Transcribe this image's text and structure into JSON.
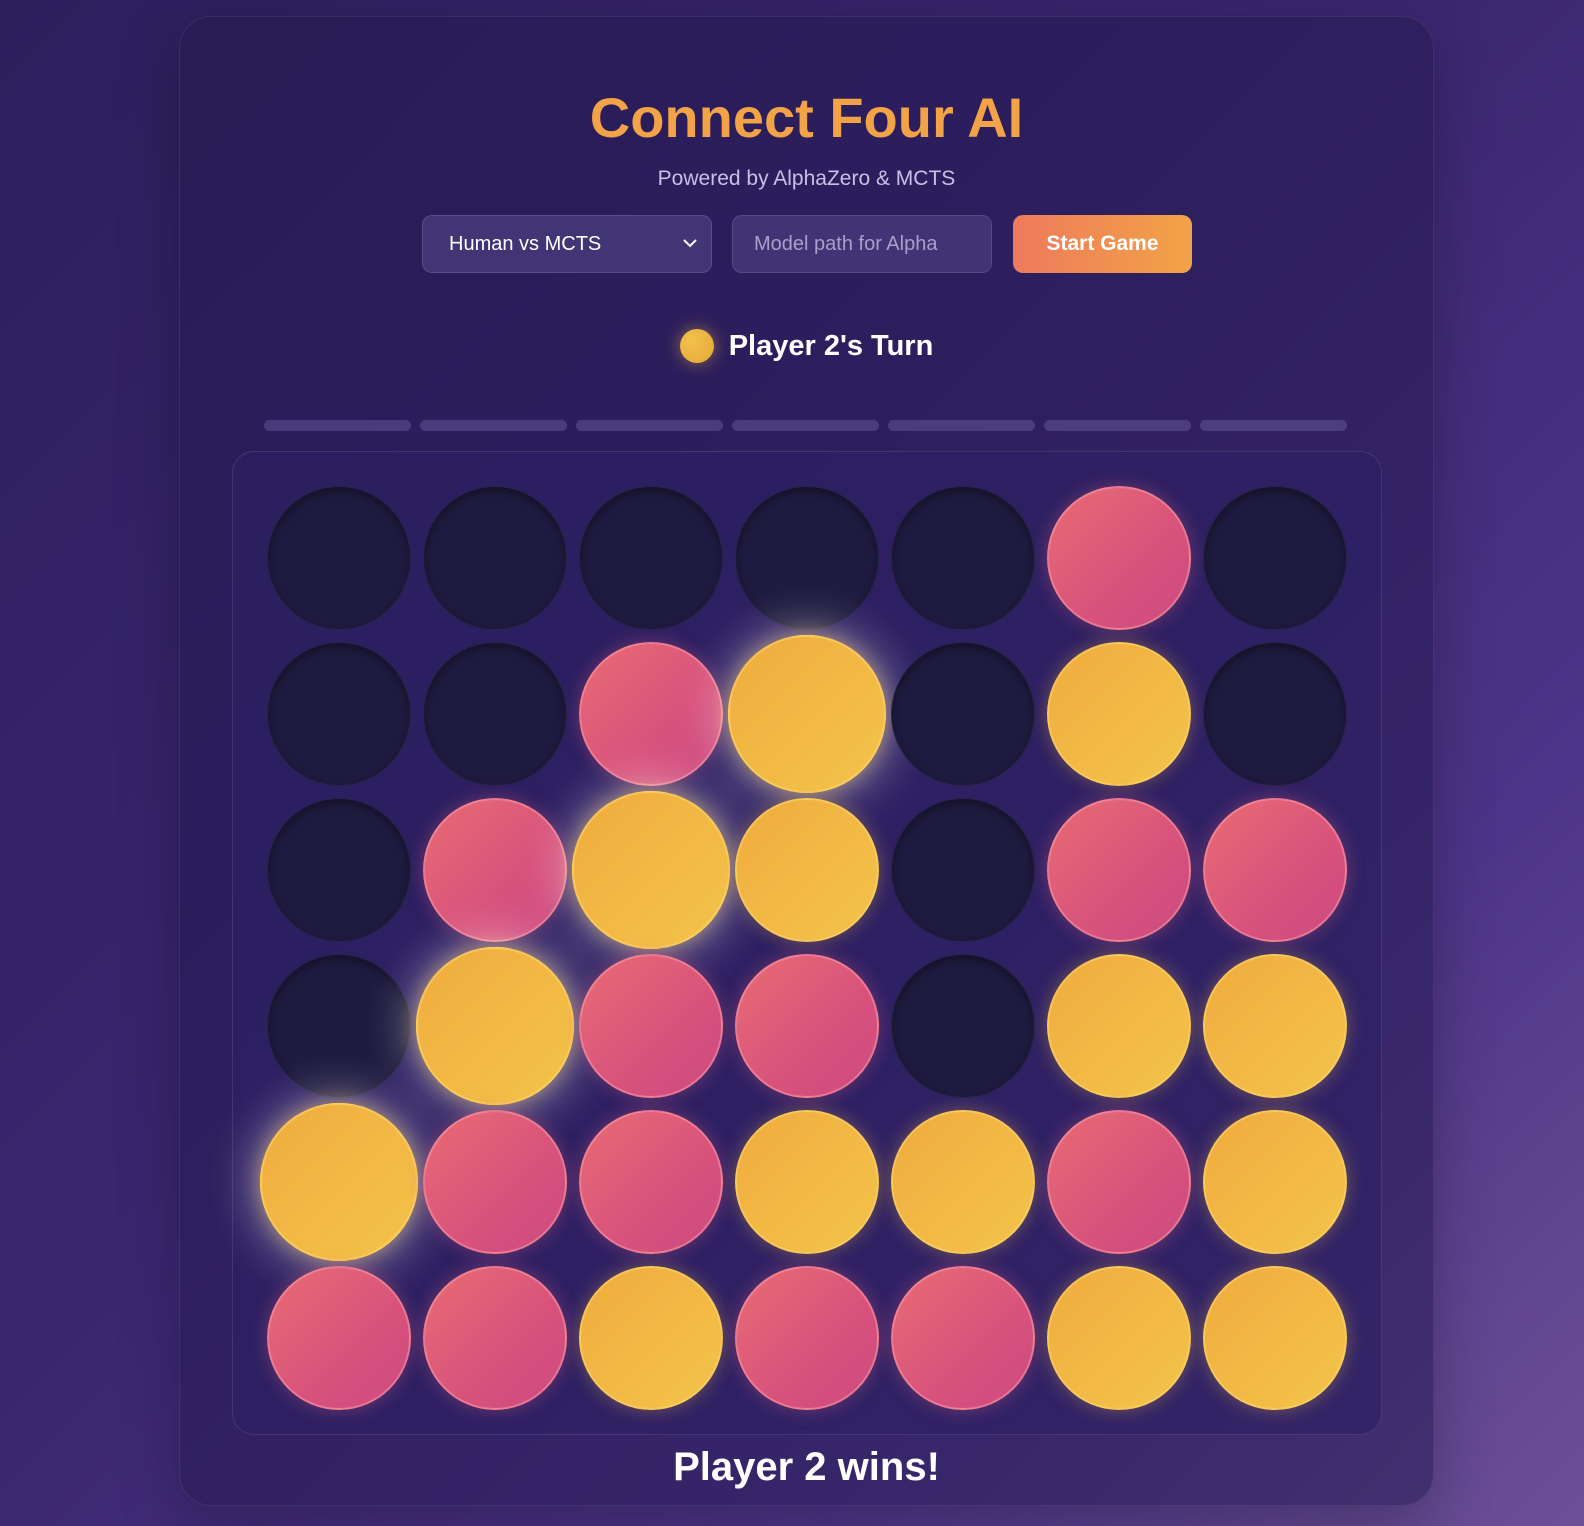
{
  "header": {
    "title": "Connect Four AI",
    "subtitle": "Powered by AlphaZero & MCTS"
  },
  "controls": {
    "mode_selected": "Human vs MCTS",
    "model_placeholder": "Model path for Alpha",
    "model_value": "",
    "start_label": "Start Game"
  },
  "status": {
    "turn_text": "Player 2's Turn",
    "turn_player": 2,
    "result_text": "Player 2 wins!"
  },
  "colors": {
    "player1": "#d8527c",
    "player2": "#f3c44a",
    "empty": "#1f1b40",
    "accent": "#f2a347"
  },
  "board": {
    "rows": 6,
    "cols": 7,
    "grid": [
      [
        0,
        0,
        0,
        0,
        0,
        1,
        0
      ],
      [
        0,
        0,
        1,
        2,
        0,
        2,
        0
      ],
      [
        0,
        1,
        2,
        2,
        0,
        1,
        1
      ],
      [
        0,
        2,
        1,
        1,
        0,
        2,
        2
      ],
      [
        2,
        1,
        1,
        2,
        2,
        1,
        2
      ],
      [
        1,
        1,
        2,
        1,
        1,
        2,
        2
      ]
    ],
    "winning_cells": [
      [
        4,
        0
      ],
      [
        3,
        1
      ],
      [
        2,
        2
      ],
      [
        1,
        3
      ]
    ]
  }
}
